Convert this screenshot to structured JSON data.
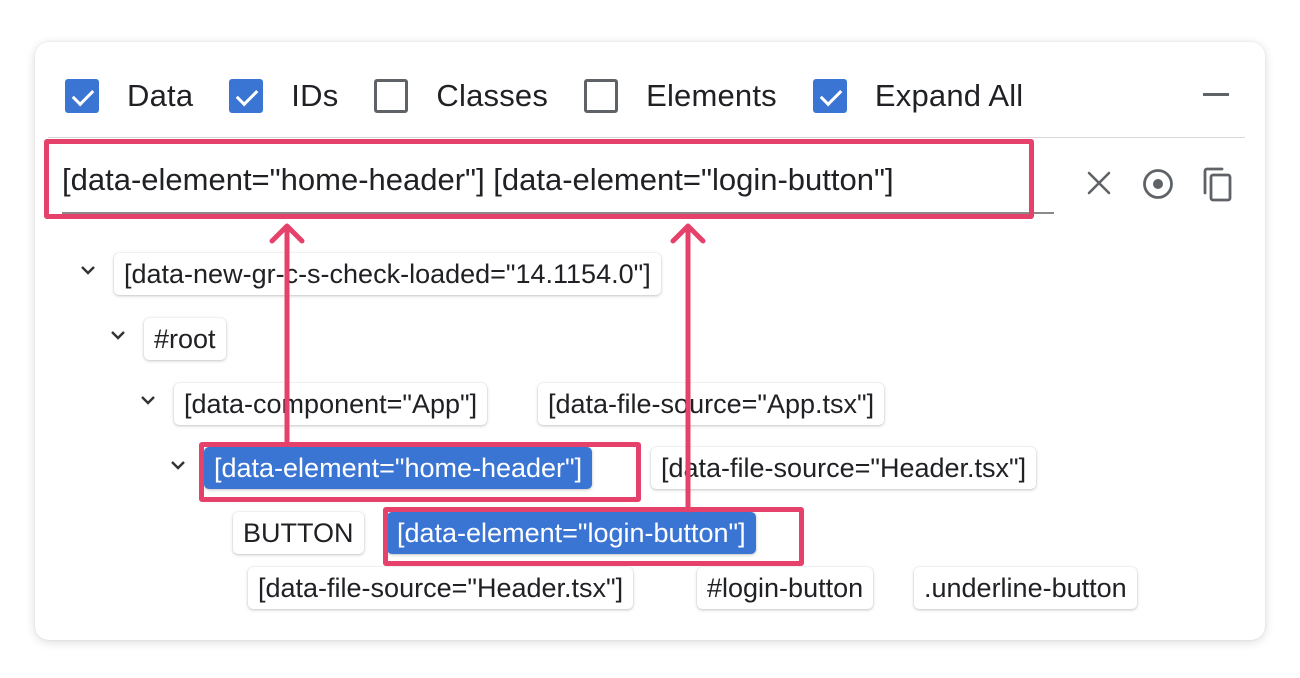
{
  "filters": [
    {
      "label": "Data",
      "checked": true
    },
    {
      "label": "IDs",
      "checked": true
    },
    {
      "label": "Classes",
      "checked": false
    },
    {
      "label": "Elements",
      "checked": false
    },
    {
      "label": "Expand All",
      "checked": true
    }
  ],
  "selector": {
    "value": "[data-element=\"home-header\"] [data-element=\"login-button\"]"
  },
  "tree": {
    "level0": [
      "[data-new-gr-c-s-check-loaded=\"14.1154.0\"]"
    ],
    "level1": [
      "#root"
    ],
    "level2": [
      "[data-component=\"App\"]",
      "[data-file-source=\"App.tsx\"]"
    ],
    "level3": [
      "[data-element=\"home-header\"]",
      "[data-file-source=\"Header.tsx\"]"
    ],
    "level4": [
      "BUTTON",
      "[data-element=\"login-button\"]"
    ],
    "level5": [
      "[data-file-source=\"Header.tsx\"]",
      "#login-button",
      ".underline-button"
    ]
  },
  "colors": {
    "accent": "#3b75d3",
    "highlight": "#e6416a"
  },
  "icons": {
    "clear": "close-icon",
    "pick": "target-icon",
    "copy": "copy-icon",
    "collapse": "minus-icon",
    "expand": "chevron-down-icon"
  }
}
